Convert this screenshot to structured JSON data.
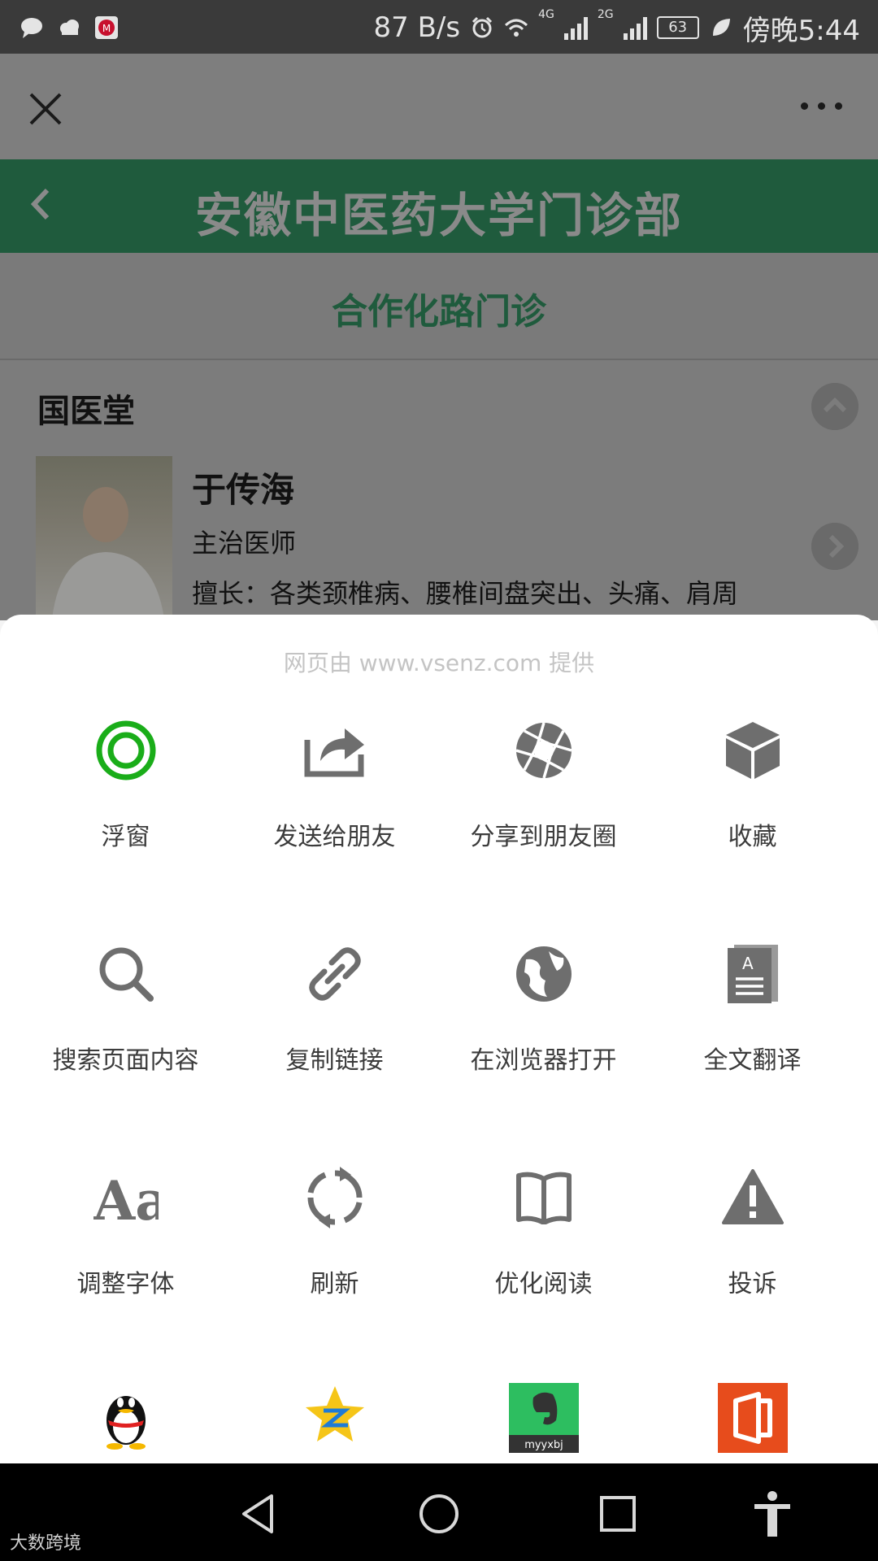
{
  "status_bar": {
    "speed": "87 B/s",
    "network_4g": "4G",
    "network_2g": "2G",
    "battery": "63",
    "time": "傍晚5:44"
  },
  "page": {
    "title": "安徽中医药大学门诊部",
    "subtitle": "合作化路门诊",
    "section": "国医堂",
    "doctor": {
      "name": "于传海",
      "title": "主治医师",
      "skill": "擅长：各类颈椎病、腰椎间盘突出、头痛、肩周"
    }
  },
  "sheet": {
    "provider": "网页由 www.vsenz.com 提供",
    "actions": [
      {
        "label": "浮窗",
        "icon": "floating-window-icon"
      },
      {
        "label": "发送给朋友",
        "icon": "share-to-friend-icon"
      },
      {
        "label": "分享到朋友圈",
        "icon": "moments-icon"
      },
      {
        "label": "收藏",
        "icon": "favorite-cube-icon"
      },
      {
        "label": "搜索页面内容",
        "icon": "search-icon"
      },
      {
        "label": "复制链接",
        "icon": "link-icon"
      },
      {
        "label": "在浏览器打开",
        "icon": "globe-icon"
      },
      {
        "label": "全文翻译",
        "icon": "translate-icon"
      },
      {
        "label": "调整字体",
        "icon": "font-size-icon"
      },
      {
        "label": "刷新",
        "icon": "refresh-icon"
      },
      {
        "label": "优化阅读",
        "icon": "book-icon"
      },
      {
        "label": "投诉",
        "icon": "warning-icon"
      }
    ],
    "apps": [
      {
        "name": "qq-app-icon"
      },
      {
        "name": "qzone-app-icon"
      },
      {
        "name": "evernote-app-icon",
        "label": "myyxbj"
      },
      {
        "name": "office-app-icon"
      }
    ],
    "accent": "#1aad19"
  },
  "watermark": "大数跨境"
}
